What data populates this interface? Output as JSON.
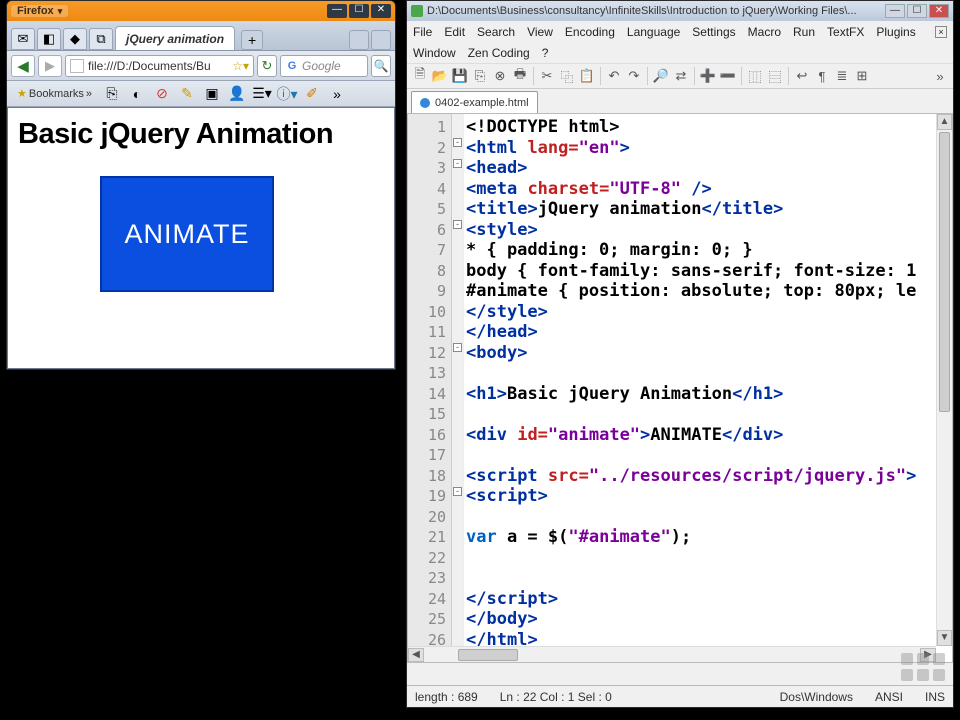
{
  "firefox": {
    "app_label": "Firefox",
    "tab_title": "jQuery animation",
    "new_tab_plus": "+",
    "url": "file:///D:/Documents/Bu",
    "search_placeholder": "Google",
    "bookmarks_label": "Bookmarks",
    "page_heading": "Basic jQuery Animation",
    "animate_text": "ANIMATE"
  },
  "npp": {
    "title_path": "D:\\Documents\\Business\\consultancy\\InfiniteSkills\\Introduction to jQuery\\Working Files\\...",
    "menus": [
      "File",
      "Edit",
      "Search",
      "View",
      "Encoding",
      "Language",
      "Settings",
      "Macro",
      "Run",
      "TextFX",
      "Plugins"
    ],
    "menus2": [
      "Window",
      "Zen Coding",
      "?"
    ],
    "tab_name": "0402-example.html",
    "line_numbers": [
      "1",
      "2",
      "3",
      "4",
      "5",
      "6",
      "7",
      "8",
      "9",
      "10",
      "11",
      "12",
      "13",
      "14",
      "15",
      "16",
      "17",
      "18",
      "19",
      "20",
      "21",
      "22",
      "23",
      "24",
      "25",
      "26"
    ],
    "status": {
      "length": "length : 689",
      "pos": "Ln : 22    Col : 1    Sel : 0",
      "eol": "Dos\\Windows",
      "enc": "ANSI",
      "mode": "INS"
    },
    "code": {
      "l1": "<!DOCTYPE html>",
      "l2": {
        "open": "<",
        "tag": "html",
        "attr": " lang=",
        "str": "\"en\"",
        "close": ">"
      },
      "l3": {
        "open": "<",
        "tag": "head",
        "close": ">"
      },
      "l4": {
        "open": "<",
        "tag": "meta",
        "attr": " charset=",
        "str": "\"UTF-8\"",
        "close": " />"
      },
      "l5": {
        "open": "<",
        "tag": "title",
        "close": ">",
        "text": "jQuery animation",
        "open2": "</",
        "tag2": "title",
        "close2": ">"
      },
      "l6": {
        "open": "<",
        "tag": "style",
        "close": ">"
      },
      "l7": "* { padding: 0; margin: 0; }",
      "l8": "body { font-family: sans-serif; font-size: 1",
      "l9": "#animate { position: absolute; top: 80px; le",
      "l10": {
        "open": "</",
        "tag": "style",
        "close": ">"
      },
      "l11": {
        "open": "</",
        "tag": "head",
        "close": ">"
      },
      "l12": {
        "open": "<",
        "tag": "body",
        "close": ">"
      },
      "l14": {
        "open": "<",
        "tag": "h1",
        "close": ">",
        "text": "Basic jQuery Animation",
        "open2": "</",
        "tag2": "h1",
        "close2": ">"
      },
      "l16": {
        "open": "<",
        "tag": "div",
        "attr": " id=",
        "str": "\"animate\"",
        "close": ">",
        "text": "ANIMATE",
        "open2": "</",
        "tag2": "div",
        "close2": ">"
      },
      "l18": {
        "open": "<",
        "tag": "script",
        "attr": " src=",
        "str": "\"../resources/script/jquery.js\"",
        "close": ">"
      },
      "l19": {
        "open": "<",
        "tag": "script",
        "close": ">"
      },
      "l21_a": "var",
      "l21_b": " a = $(",
      "l21_c": "\"#animate\"",
      "l21_d": ");",
      "l24": {
        "open": "</",
        "tag": "script",
        "close": ">"
      },
      "l25": {
        "open": "</",
        "tag": "body",
        "close": ">"
      },
      "l26": {
        "open": "</",
        "tag": "html",
        "close": ">"
      }
    }
  }
}
